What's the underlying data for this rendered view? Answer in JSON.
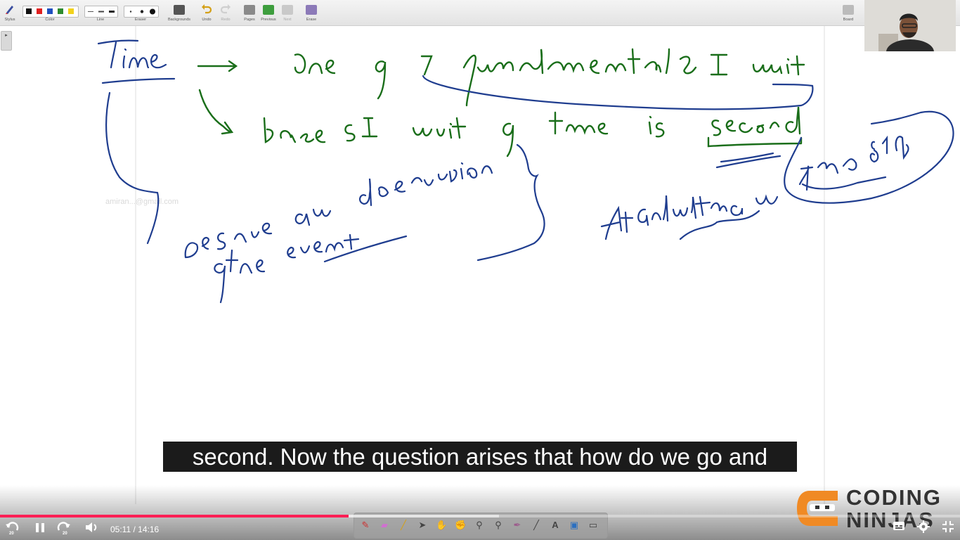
{
  "toolbar": {
    "groups": [
      {
        "name": "stylus",
        "label": "Stylus"
      },
      {
        "name": "color",
        "label": "Color"
      },
      {
        "name": "line",
        "label": "Line"
      },
      {
        "name": "eraser",
        "label": "Eraser"
      },
      {
        "name": "backgrounds",
        "label": "Backgrounds"
      },
      {
        "name": "undo",
        "label": "Undo"
      },
      {
        "name": "redo",
        "label": "Redo"
      },
      {
        "name": "pages",
        "label": "Pages"
      },
      {
        "name": "previous",
        "label": "Previous"
      },
      {
        "name": "next",
        "label": "Next"
      },
      {
        "name": "erase",
        "label": "Erase"
      },
      {
        "name": "board",
        "label": "Board"
      }
    ],
    "colors": [
      "#111111",
      "#e02020",
      "#1f4fbf",
      "#2e8b2e",
      "#f2d21b"
    ]
  },
  "whiteboard": {
    "watermark": "amiran...@gmail.com",
    "handwriting": {
      "heading": "Time",
      "line1": "One of 7 fundamental SI unit",
      "line2": "base SI unit of time is second",
      "note1": "Describe an observation of the event",
      "note2": "At calculated on 7th dec 814"
    }
  },
  "caption": "second. Now the question arises that how do we go and",
  "brand": {
    "line1": "CODING",
    "line2": "NINJAS"
  },
  "player": {
    "current_time": "05:11",
    "total_time": "14:16",
    "time_display": "05:11 / 14:16",
    "progress_fraction": 0.363,
    "buffered_fraction": 0.52,
    "skip_seconds": "20"
  },
  "colors": {
    "ink_green": "#1a6e1a",
    "ink_blue": "#1a3a8c",
    "progress": "#ff1f55"
  }
}
